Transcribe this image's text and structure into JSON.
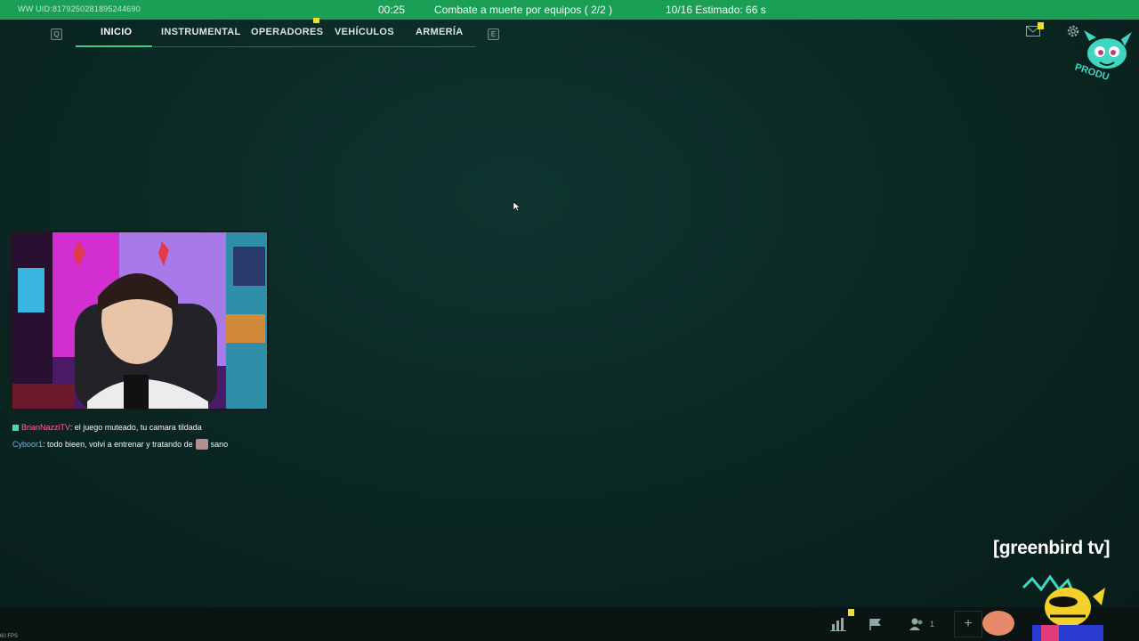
{
  "status_bar": {
    "uid": "WW UID:8179250281895244690",
    "timer": "00:25",
    "mode": "Combate a muerte por equipos ( 2/2 )",
    "queue": "10/16  Estimado: 66 s"
  },
  "nav": {
    "left_key": "Q",
    "right_key": "E",
    "tabs": [
      "INICIO",
      "INSTRUMENTAL",
      "OPERADORES",
      "VEHÍCULOS",
      "ARMERÍA"
    ],
    "active_tab": "INICIO"
  },
  "logo": {
    "text": "PRODU"
  },
  "chat": {
    "messages": [
      {
        "user": "BrianNazziTV",
        "text": ": el juego muteado, tu camara tildada"
      },
      {
        "user": "Cyboor1",
        "text": ": todo bieen, volvi a entrenar y tratando de",
        "after_emote": "sano"
      }
    ]
  },
  "channel_tag": "[greenbird tv]",
  "bottom_bar": {
    "fps": "60 FPS",
    "squad_count": "1",
    "plus": "+"
  },
  "colors": {
    "accent_green": "#1b9e55",
    "tab_underline": "#37d07e",
    "notification": "#e8e034",
    "background": "#0b2420"
  }
}
